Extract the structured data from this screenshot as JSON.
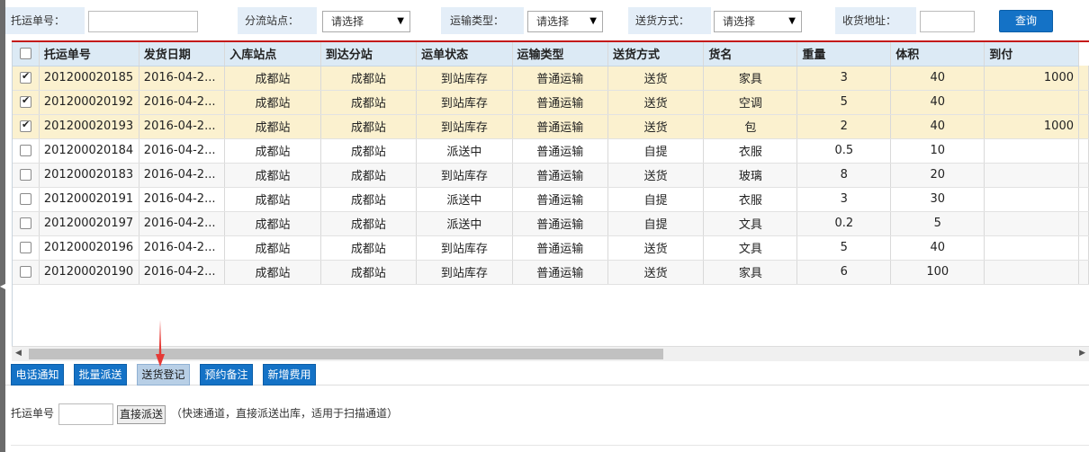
{
  "filters": {
    "waybill_label": "托运单号：",
    "site_label": "分流站点：",
    "site_value": "请选择",
    "transport_label": "运输类型：",
    "transport_value": "请选择",
    "delivery_label": "送货方式：",
    "delivery_value": "请选择",
    "address_label": "收货地址：",
    "query_label": "查询"
  },
  "table": {
    "columns": [
      "托运单号",
      "发货日期",
      "入库站点",
      "到达分站",
      "运单状态",
      "运输类型",
      "送货方式",
      "货名",
      "重量",
      "体积",
      "到付"
    ],
    "rows": [
      {
        "checked": true,
        "waybill": "201200020185",
        "date": "2016-04-2...",
        "in_site": "成都站",
        "arrive": "成都站",
        "status": "到站库存",
        "transport": "普通运输",
        "delivery": "送货",
        "goods": "家具",
        "weight": "3",
        "volume": "40",
        "cod": "1000"
      },
      {
        "checked": true,
        "waybill": "201200020192",
        "date": "2016-04-2...",
        "in_site": "成都站",
        "arrive": "成都站",
        "status": "到站库存",
        "transport": "普通运输",
        "delivery": "送货",
        "goods": "空调",
        "weight": "5",
        "volume": "40",
        "cod": ""
      },
      {
        "checked": true,
        "waybill": "201200020193",
        "date": "2016-04-2...",
        "in_site": "成都站",
        "arrive": "成都站",
        "status": "到站库存",
        "transport": "普通运输",
        "delivery": "送货",
        "goods": "包",
        "weight": "2",
        "volume": "40",
        "cod": "1000"
      },
      {
        "checked": false,
        "waybill": "201200020184",
        "date": "2016-04-2...",
        "in_site": "成都站",
        "arrive": "成都站",
        "status": "派送中",
        "transport": "普通运输",
        "delivery": "自提",
        "goods": "衣服",
        "weight": "0.5",
        "volume": "10",
        "cod": ""
      },
      {
        "checked": false,
        "waybill": "201200020183",
        "date": "2016-04-2...",
        "in_site": "成都站",
        "arrive": "成都站",
        "status": "到站库存",
        "transport": "普通运输",
        "delivery": "送货",
        "goods": "玻璃",
        "weight": "8",
        "volume": "20",
        "cod": ""
      },
      {
        "checked": false,
        "waybill": "201200020191",
        "date": "2016-04-2...",
        "in_site": "成都站",
        "arrive": "成都站",
        "status": "派送中",
        "transport": "普通运输",
        "delivery": "自提",
        "goods": "衣服",
        "weight": "3",
        "volume": "30",
        "cod": ""
      },
      {
        "checked": false,
        "waybill": "201200020197",
        "date": "2016-04-2...",
        "in_site": "成都站",
        "arrive": "成都站",
        "status": "派送中",
        "transport": "普通运输",
        "delivery": "自提",
        "goods": "文具",
        "weight": "0.2",
        "volume": "5",
        "cod": ""
      },
      {
        "checked": false,
        "waybill": "201200020196",
        "date": "2016-04-2...",
        "in_site": "成都站",
        "arrive": "成都站",
        "status": "到站库存",
        "transport": "普通运输",
        "delivery": "送货",
        "goods": "文具",
        "weight": "5",
        "volume": "40",
        "cod": ""
      },
      {
        "checked": false,
        "waybill": "201200020190",
        "date": "2016-04-2...",
        "in_site": "成都站",
        "arrive": "成都站",
        "status": "到站库存",
        "transport": "普通运输",
        "delivery": "送货",
        "goods": "家具",
        "weight": "6",
        "volume": "100",
        "cod": ""
      }
    ]
  },
  "actions": [
    "电话通知",
    "批量派送",
    "送货登记",
    "预约备注",
    "新增费用"
  ],
  "quick": {
    "label": "托运单号",
    "button": "直接派送",
    "hint": "（快速通道，直接派送出库，适用于扫描通道）"
  },
  "colors": {
    "accent": "#1472c6",
    "selected_row": "#fbf1cf",
    "header_bg": "#dceaf5",
    "red_rule": "#c41a1a",
    "arrow": "#e53935"
  },
  "icons": {
    "dropdown": "triangle-down",
    "scroll_left": "triangle-left",
    "scroll_right": "triangle-right",
    "checkbox": "check-mark"
  }
}
